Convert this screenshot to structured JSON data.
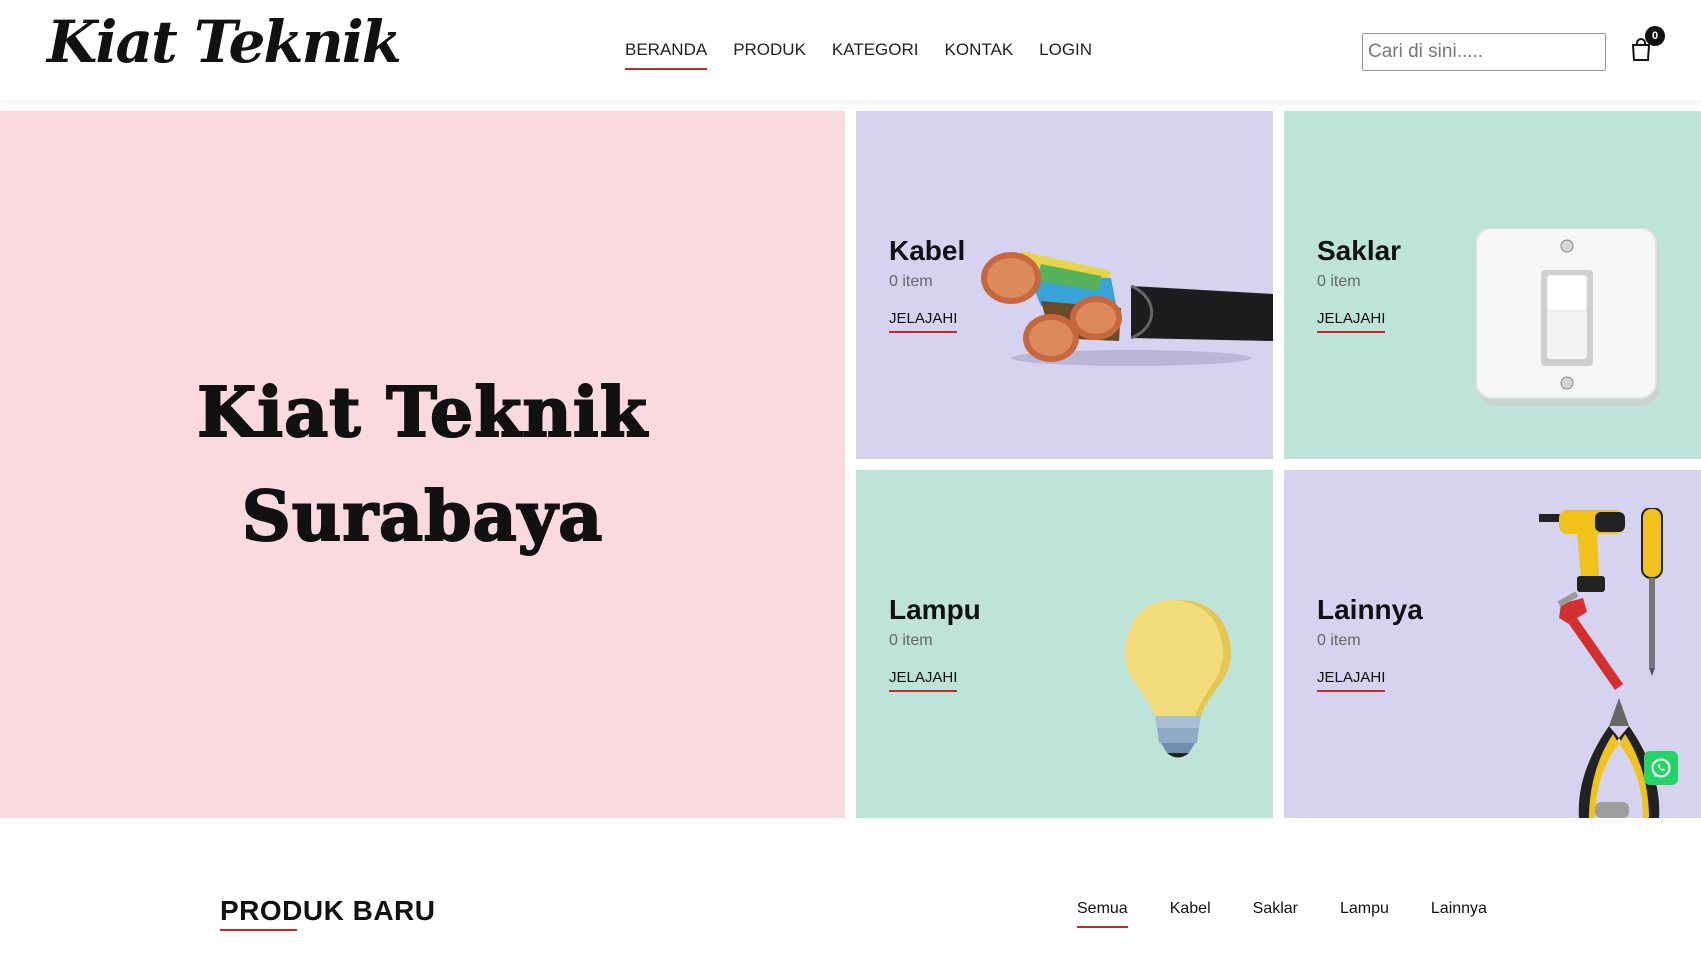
{
  "header": {
    "logo": "Kiat Teknik",
    "nav": [
      "BERANDA",
      "PRODUK",
      "KATEGORI",
      "KONTAK",
      "LOGIN"
    ],
    "active_nav": "BERANDA",
    "search_placeholder": "Cari di sini.....",
    "cart_count": "0"
  },
  "hero": {
    "title": "Kiat Teknik\nSurabaya",
    "bg": "#fadadf"
  },
  "categories": [
    {
      "name": "Kabel",
      "count": "0 item",
      "link": "JELAJAHI",
      "bg": "#d5d3ef"
    },
    {
      "name": "Saklar",
      "count": "0 item",
      "link": "JELAJAHI",
      "bg": "#bee3d9"
    },
    {
      "name": "Lampu",
      "count": "0 item",
      "link": "JELAJAHI",
      "bg": "#bee3d9"
    },
    {
      "name": "Lainnya",
      "count": "0 item",
      "link": "JELAJAHI",
      "bg": "#d5d3ef"
    }
  ],
  "new_products": {
    "title": "PRODUK BARU",
    "filters": [
      "Semua",
      "Kabel",
      "Saklar",
      "Lampu",
      "Lainnya"
    ],
    "active_filter": "Semua"
  },
  "colors": {
    "accent": "#c62828",
    "whatsapp": "#25d366"
  },
  "icons": [
    "cart-icon",
    "whatsapp-icon"
  ]
}
